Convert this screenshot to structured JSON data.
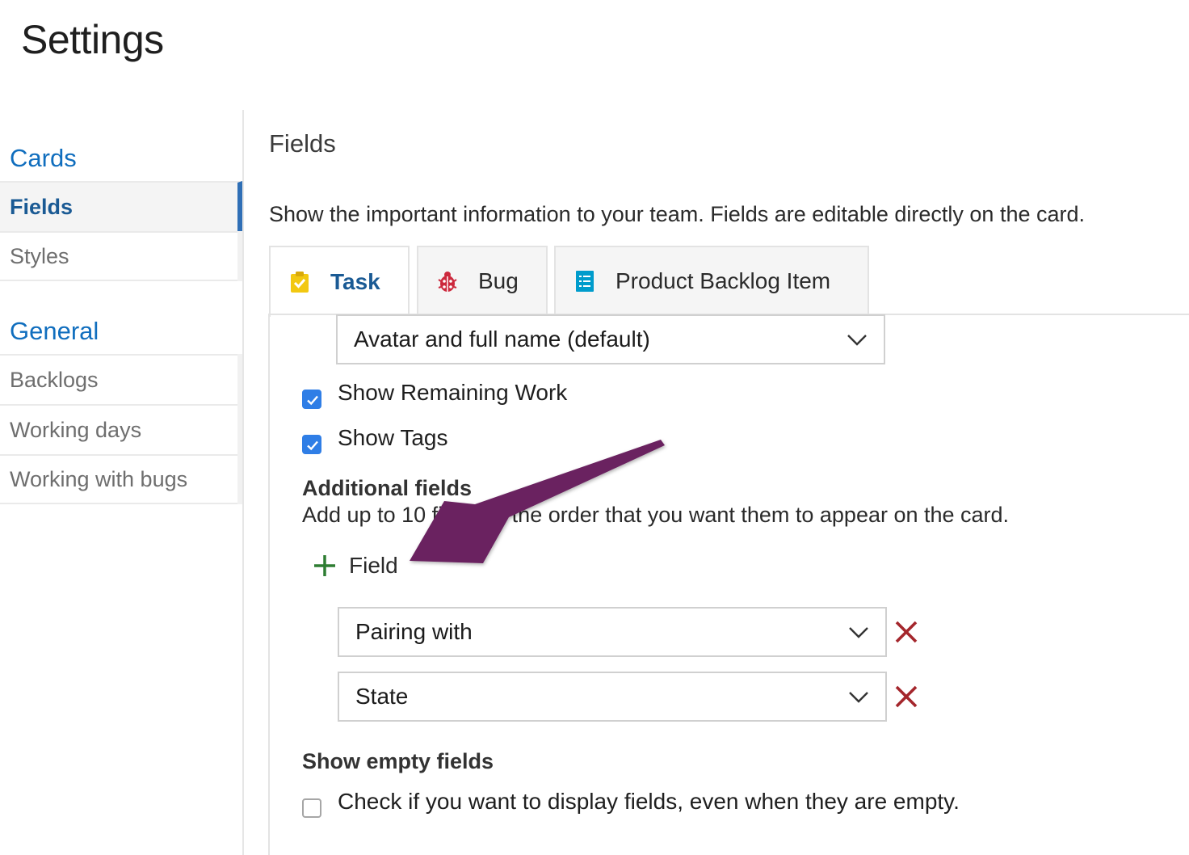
{
  "page": {
    "title": "Settings"
  },
  "sidebar": {
    "groups": [
      {
        "title": "Cards",
        "items": [
          {
            "label": "Fields",
            "active": true
          },
          {
            "label": "Styles",
            "active": false
          }
        ]
      },
      {
        "title": "General",
        "items": [
          {
            "label": "Backlogs"
          },
          {
            "label": "Working days"
          },
          {
            "label": "Working with bugs"
          }
        ]
      }
    ]
  },
  "main": {
    "section_title": "Fields",
    "description": "Show the important information to your team. Fields are editable directly on the card.",
    "tabs": [
      {
        "label": "Task",
        "icon": "task-clipboard-icon",
        "active": true
      },
      {
        "label": "Bug",
        "icon": "bug-icon"
      },
      {
        "label": "Product Backlog Item",
        "icon": "backlog-item-icon"
      }
    ],
    "assigned_to_select": {
      "value": "Avatar and full name (default)"
    },
    "options": [
      {
        "label": "Show Remaining Work",
        "checked": true
      },
      {
        "label": "Show Tags",
        "checked": true
      }
    ],
    "additional_fields": {
      "heading": "Additional fields",
      "help": "Add up to 10 fields in the order that you want them to appear on the card.",
      "add_label": "Field",
      "fields": [
        {
          "value": "Pairing with"
        },
        {
          "value": "State"
        }
      ]
    },
    "empty_fields": {
      "heading": "Show empty fields",
      "label": "Check if you want to display fields, even when they are empty.",
      "checked": false
    }
  },
  "colors": {
    "accent_blue": "#106ebe",
    "checkbox_blue": "#2f7ee6",
    "add_green": "#2e7d32",
    "remove_red": "#a4262c",
    "annotation_arrow": "#6b2460"
  }
}
